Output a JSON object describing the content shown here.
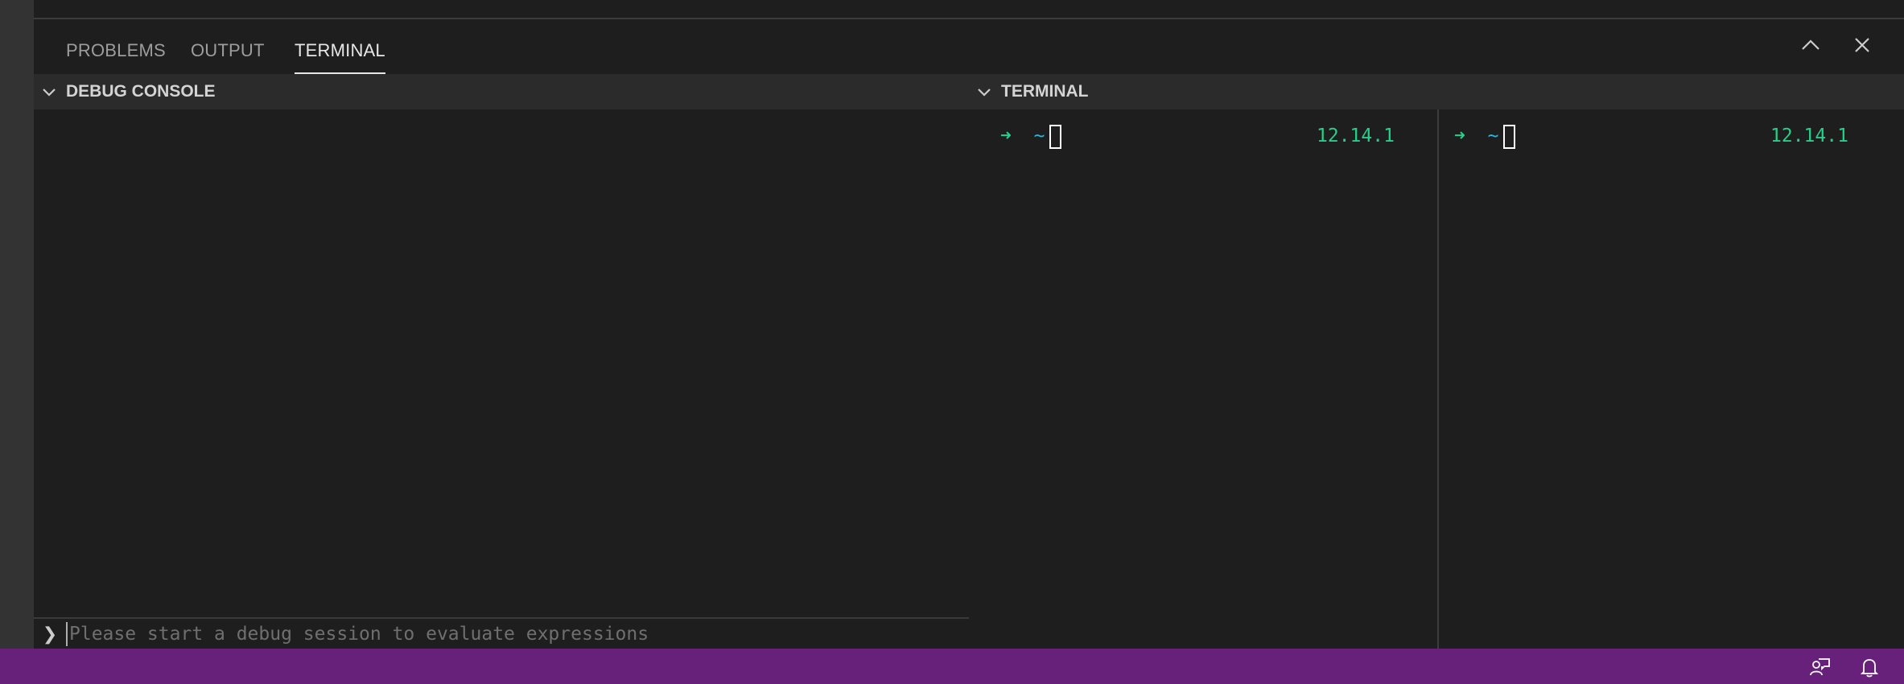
{
  "panel": {
    "tabs": [
      {
        "label": "PROBLEMS",
        "active": false
      },
      {
        "label": "OUTPUT",
        "active": false
      },
      {
        "label": "TERMINAL",
        "active": true
      }
    ],
    "actions": [
      {
        "icon": "chevron-up-icon"
      },
      {
        "icon": "close-icon"
      }
    ]
  },
  "debug_console": {
    "header": "DEBUG CONSOLE",
    "input_chevron": "❯",
    "input_placeholder": "Please start a debug session to evaluate expressions"
  },
  "terminal": {
    "header": "TERMINAL",
    "panes": [
      {
        "arrow": "➜",
        "cwd": "~",
        "version": "12.14.1"
      },
      {
        "arrow": "➜",
        "cwd": "~",
        "version": "12.14.1"
      }
    ]
  },
  "statusbar": {
    "color": "#68217a",
    "icons": [
      "feedback-icon",
      "bell-icon"
    ]
  }
}
